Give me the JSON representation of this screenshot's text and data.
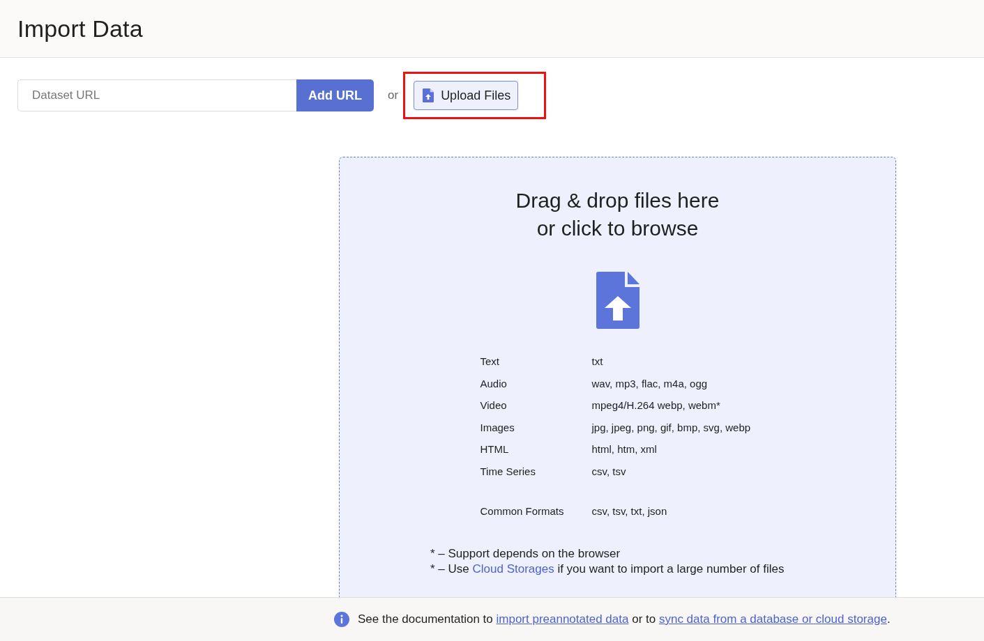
{
  "header": {
    "title": "Import Data"
  },
  "url_form": {
    "placeholder": "Dataset URL",
    "button": "Add URL"
  },
  "or_label": "or",
  "upload_button": {
    "label": "Upload Files",
    "highlighted": true
  },
  "dropzone": {
    "heading_lines": [
      "Drag & drop files here",
      "or click to browse"
    ],
    "formats": [
      {
        "kind": "format",
        "type": "Text",
        "extensions": "txt"
      },
      {
        "kind": "format",
        "type": "Audio",
        "extensions": "wav, mp3, flac, m4a, ogg"
      },
      {
        "kind": "format",
        "type": "Video",
        "extensions": "mpeg4/H.264 webp, webm*"
      },
      {
        "kind": "format",
        "type": "Images",
        "extensions": "jpg, jpeg, png, gif, bmp, svg, webp"
      },
      {
        "kind": "format",
        "type": "HTML",
        "extensions": "html, htm, xml"
      },
      {
        "kind": "format",
        "type": "Time Series",
        "extensions": "csv, tsv"
      },
      {
        "kind": "summary",
        "type": "Common Formats",
        "extensions": "csv, tsv, txt, json"
      }
    ],
    "notes": [
      {
        "prefix": "* – Support depends on the browser"
      },
      {
        "prefix": "* – Use ",
        "link": "Cloud Storages",
        "suffix": " if you want to import a large number of files"
      }
    ]
  },
  "footer": {
    "prefix": "See the documentation to ",
    "link_1": "import preannotated data",
    "middle": " or to ",
    "link_2": "sync data from a database or cloud storage",
    "suffix": "."
  }
}
